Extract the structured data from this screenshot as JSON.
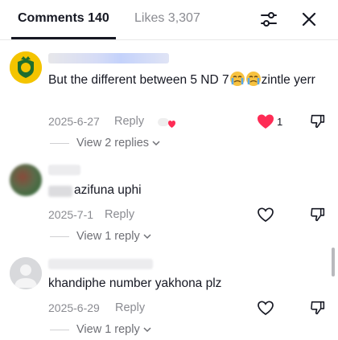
{
  "header": {
    "tab_comments": "Comments 140",
    "tab_likes": "Likes 3,307",
    "filter_icon": "sliders-icon",
    "close_icon": "close-icon"
  },
  "comments": [
    {
      "text_before": "But the different between 5 ND 7",
      "emojis": [
        "crying-face-emoji",
        "crying-face-emoji"
      ],
      "text_after": "zintle yerr",
      "date": "2025-6-27",
      "reply_label": "Reply",
      "liked": true,
      "like_count": "1",
      "view_replies": "View 2 replies"
    },
    {
      "text": "azifuna uphi",
      "date": "2025-7-1",
      "reply_label": "Reply",
      "liked": false,
      "view_replies": "View 1 reply"
    },
    {
      "text": "khandiphe number yakhona plz",
      "date": "2025-6-29",
      "reply_label": "Reply",
      "liked": false,
      "view_replies": "View 1 reply"
    }
  ],
  "colors": {
    "accent_like": "#fe2c55",
    "text_primary": "#161823",
    "text_secondary": "#8a8b91"
  }
}
